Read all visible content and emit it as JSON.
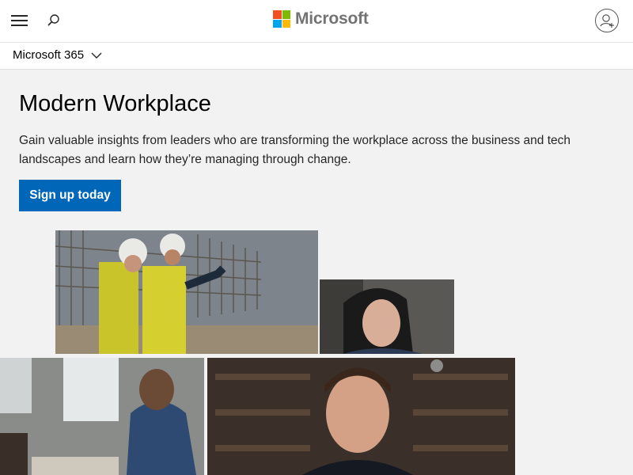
{
  "header": {
    "brand_name": "Microsoft",
    "logo_colors": [
      "#f25022",
      "#7fba00",
      "#00a4ef",
      "#ffb900"
    ],
    "icons": {
      "menu": "hamburger-icon",
      "search": "search-icon",
      "account": "account-icon"
    }
  },
  "subnav": {
    "product_label": "Microsoft 365",
    "icon": "chevron-down-icon"
  },
  "hero": {
    "title": "Modern Workplace",
    "description": "Gain valuable insights from leaders who are transforming the workplace across the business and tech landscapes and learn how they’re managing through change.",
    "cta_label": "Sign up today",
    "accent_color": "#0067b8"
  }
}
